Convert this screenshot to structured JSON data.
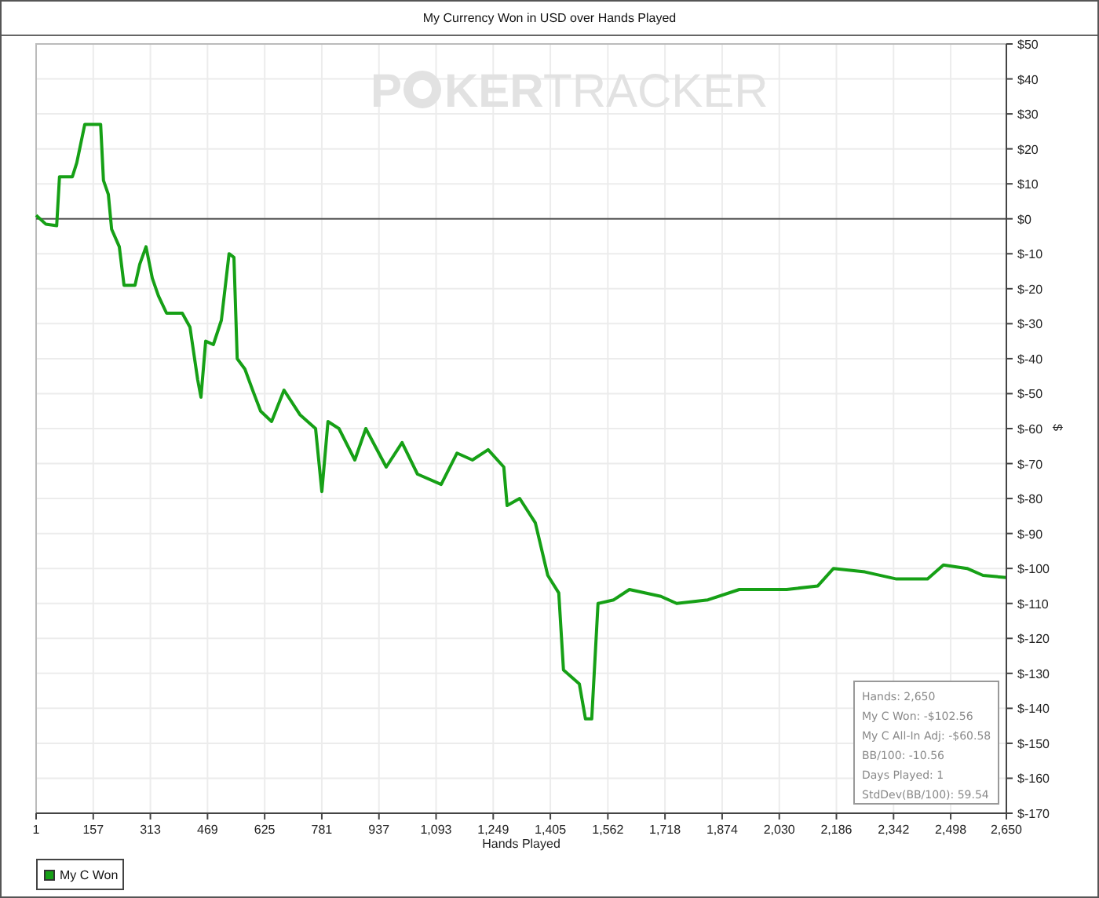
{
  "chart_title": "My Currency Won in USD over Hands Played",
  "logo": {
    "left": "P",
    "middle": "KER",
    "right": "TRACKER"
  },
  "chart_data": {
    "type": "line",
    "grid": true,
    "xlabel": "Hands Played",
    "ylabel": "$",
    "xlim": [
      1,
      2650
    ],
    "ylim": [
      -170,
      50
    ],
    "xticks": [
      1,
      157,
      {
        "value": 313,
        "label": "313"
      },
      {
        "value": 469,
        "label": "469"
      },
      {
        "value": 625,
        "label": "625"
      },
      {
        "value": 781,
        "label": "781"
      },
      {
        "value": 937,
        "label": "937"
      },
      {
        "value": 1093,
        "label": "1,093"
      },
      {
        "value": 1249,
        "label": "1,249"
      },
      {
        "value": 1405,
        "label": "1,405"
      },
      {
        "value": 1562,
        "label": "1,562"
      },
      {
        "value": 1718,
        "label": "1,718"
      },
      {
        "value": 1874,
        "label": "1,874"
      },
      {
        "value": 2030,
        "label": "2,030"
      },
      {
        "value": 2186,
        "label": "2,186"
      },
      {
        "value": 2342,
        "label": "2,342"
      },
      {
        "value": 2498,
        "label": "2,498"
      },
      {
        "value": 2650,
        "label": "2,650"
      }
    ],
    "yticks": [
      {
        "value": 50,
        "label": "$50"
      },
      {
        "value": 40,
        "label": "$40"
      },
      {
        "value": 30,
        "label": "$30"
      },
      {
        "value": 20,
        "label": "$20"
      },
      {
        "value": 10,
        "label": "$10"
      },
      {
        "value": 0,
        "label": "$0"
      },
      {
        "value": -10,
        "label": "$-10"
      },
      {
        "value": -20,
        "label": "$-20"
      },
      {
        "value": -30,
        "label": "$-30"
      },
      {
        "value": -40,
        "label": "$-40"
      },
      {
        "value": -50,
        "label": "$-50"
      },
      {
        "value": -60,
        "label": "$-60"
      },
      {
        "value": -70,
        "label": "$-70"
      },
      {
        "value": -80,
        "label": "$-80"
      },
      {
        "value": -90,
        "label": "$-90"
      },
      {
        "value": -100,
        "label": "$-100"
      },
      {
        "value": -110,
        "label": "$-110"
      },
      {
        "value": -120,
        "label": "$-120"
      },
      {
        "value": -130,
        "label": "$-130"
      },
      {
        "value": -140,
        "label": "$-140"
      },
      {
        "value": -150,
        "label": "$-150"
      },
      {
        "value": -160,
        "label": "$-160"
      },
      {
        "value": -170,
        "label": "$-170"
      }
    ],
    "x": [
      1,
      27,
      57,
      65,
      100,
      112,
      134,
      177,
      185,
      198,
      207,
      228,
      241,
      271,
      284,
      301,
      318,
      335,
      357,
      400,
      421,
      442,
      451,
      464,
      485,
      507,
      528,
      541,
      550,
      571,
      592,
      614,
      644,
      678,
      721,
      764,
      781,
      798,
      828,
      871,
      901,
      957,
      1000,
      1042,
      1107,
      1150,
      1192,
      1235,
      1278,
      1287,
      1321,
      1364,
      1398,
      1428,
      1441,
      1484,
      1501,
      1518,
      1535,
      1578,
      1621,
      1707,
      1750,
      1835,
      1921,
      2050,
      2135,
      2178,
      2264,
      2350,
      2435,
      2478,
      2543,
      2586,
      2650
    ],
    "series": [
      {
        "name": "My C Won",
        "color": "#16a016",
        "values": [
          1,
          -1.5,
          -2,
          12,
          12,
          16,
          27,
          27,
          11,
          7,
          -3,
          -8,
          -19,
          -19,
          -13,
          -8,
          -17,
          -22,
          -27,
          -27,
          -31,
          -46,
          -51,
          -35,
          -36,
          -29,
          -10,
          -11,
          -40,
          -43,
          -49,
          -55,
          -58,
          -49,
          -56,
          -60,
          -78,
          -58,
          -60,
          -69,
          -60,
          -71,
          -64,
          -73,
          -76,
          -67,
          -69,
          -66,
          -71,
          -82,
          -80,
          -87,
          -102,
          -107,
          -129,
          -133,
          -143,
          -143,
          -110,
          -109,
          -106,
          -108,
          -110,
          -109,
          -106,
          -106,
          -105,
          -100,
          -101,
          -103,
          -103,
          -99,
          -100,
          -102,
          -102.6
        ]
      }
    ]
  },
  "stats": [
    "Hands: 2,650",
    "My C Won: -$102.56",
    "My C All-In Adj: -$60.58",
    "BB/100: -10.56",
    "Days Played: 1",
    "StdDev(BB/100): 59.54"
  ]
}
